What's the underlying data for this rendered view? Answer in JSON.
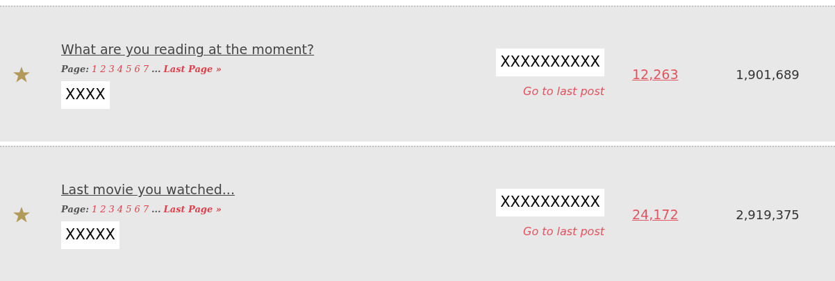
{
  "threads": [
    {
      "title": "What are you reading at the moment?",
      "page_label": "Page:",
      "pages": [
        "1",
        "2",
        "3",
        "4",
        "5",
        "6",
        "7"
      ],
      "ellipsis": "...",
      "last_page": "Last Page »",
      "author": "XXXX",
      "last_poster": "XXXXXXXXXX",
      "last_post_link": "Go to last post",
      "replies": "12,263",
      "views": "1,901,689"
    },
    {
      "title": "Last movie you watched...",
      "page_label": "Page:",
      "pages": [
        "1",
        "2",
        "3",
        "4",
        "5",
        "6",
        "7"
      ],
      "ellipsis": "...",
      "last_page": "Last Page »",
      "author": "XXXXX",
      "last_poster": "XXXXXXXXXX",
      "last_post_link": "Go to last post",
      "replies": "24,172",
      "views": "2,919,375"
    }
  ]
}
